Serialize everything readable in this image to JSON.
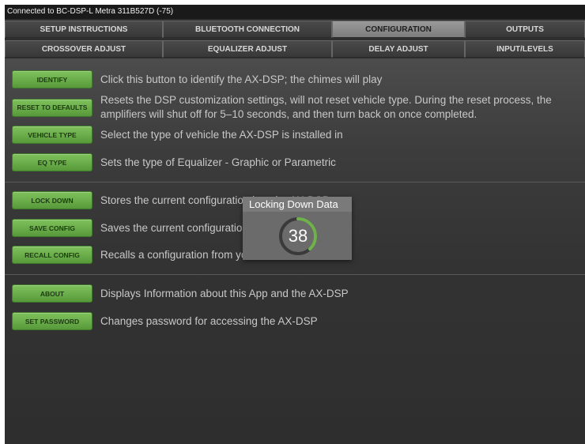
{
  "status_bar": {
    "text": "Connected to BC-DSP-L Metra 311B527D (-75)"
  },
  "tabs_row1": [
    {
      "label": "SETUP INSTRUCTIONS",
      "active": false
    },
    {
      "label": "BLUETOOTH CONNECTION",
      "active": false
    },
    {
      "label": "CONFIGURATION",
      "active": true
    },
    {
      "label": "OUTPUTS",
      "active": false
    }
  ],
  "tabs_row2": [
    {
      "label": "CROSSOVER ADJUST"
    },
    {
      "label": "EQUALIZER ADJUST"
    },
    {
      "label": "DELAY ADJUST"
    },
    {
      "label": "INPUT/LEVELS"
    }
  ],
  "rows": [
    {
      "button": "IDENTIFY",
      "description": "Click this button to identify the AX-DSP; the chimes will play"
    },
    {
      "button": "RESET TO DEFAULTS",
      "description": "Resets the DSP customization settings, will not reset vehicle type. During the reset process, the amplifiers will shut off for 5–10 seconds, and then turn back on once completed."
    },
    {
      "button": "VEHICLE TYPE",
      "description": "Select the type of vehicle the AX-DSP is installed in"
    },
    {
      "button": "EQ TYPE",
      "description": "Sets the type of Equalizer - Graphic or Parametric"
    },
    {
      "button": "LOCK DOWN",
      "description": "Stores the current configuration into the AX-DSP"
    },
    {
      "button": "SAVE CONFIG",
      "description": "Saves the current configuration"
    },
    {
      "button": "RECALL CONFIG",
      "description": "Recalls a configuration from your device"
    },
    {
      "button": "ABOUT",
      "description": "Displays Information about this App and the AX-DSP"
    },
    {
      "button": "SET PASSWORD",
      "description": "Changes password for accessing the AX-DSP"
    }
  ],
  "dialog": {
    "title": "Locking Down Data",
    "countdown": "38",
    "progress_fraction": 0.38
  },
  "colors": {
    "accent_green": "#6fb24c",
    "spinner_track": "#3a3a3a"
  }
}
